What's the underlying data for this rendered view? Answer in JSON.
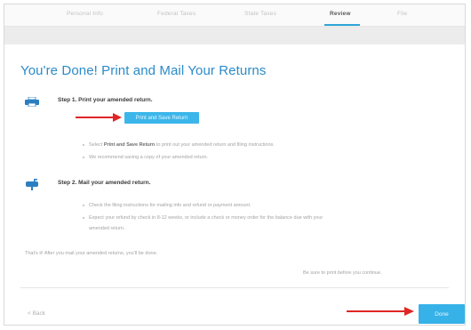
{
  "tabs": [
    {
      "label": "Personal Info",
      "active": false
    },
    {
      "label": "Federal Taxes",
      "active": false
    },
    {
      "label": "State Taxes",
      "active": false
    },
    {
      "label": "Review",
      "active": true
    },
    {
      "label": "File",
      "active": false
    }
  ],
  "page_title": "You're Done! Print and Mail Your Returns",
  "step1": {
    "title": "Step 1. Print your amended return.",
    "button_label": "Print and Save Return",
    "bullets": [
      {
        "bold": "Print and Save Return",
        "prefix": "Select ",
        "suffix": " to print out your amended return and filing instructions."
      },
      {
        "text": "We recommend saving a copy of your amended return."
      }
    ]
  },
  "step2": {
    "title": "Step 2. Mail your amended return.",
    "bullets": [
      "Check the filing instructions for mailing info and refund or payment amount.",
      "Expect your refund by check in 8-12 weeks, or include a check or money order for the balance due with your",
      "amended return."
    ]
  },
  "done_text": "That's it! After you mail your amended returns, you'll be done.",
  "note_text": "Be sure to print before you continue.",
  "back_label": "< Back",
  "done_button_label": "Done",
  "colors": {
    "accent": "#3cb6ea",
    "title": "#2b8bc9",
    "arrow": "#e02626"
  }
}
